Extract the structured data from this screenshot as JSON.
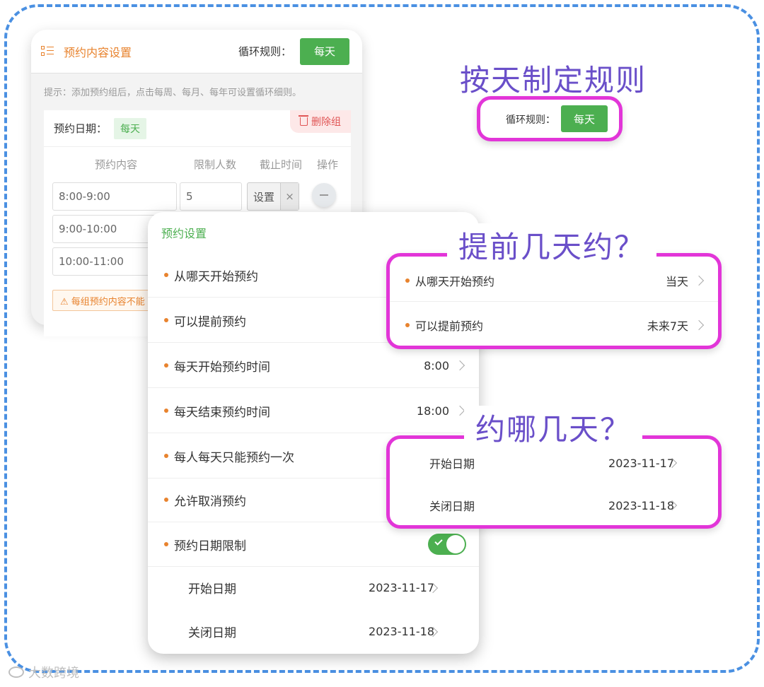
{
  "back_card": {
    "title": "预约内容设置",
    "rule_label": "循环规则：",
    "rule_value": "每天",
    "tip": "提示：添加预约组后，点击每周、每月、每年可设置循环细则。",
    "group": {
      "date_label": "预约日期：",
      "date_tag": "每天",
      "delete_label": "删除组",
      "columns": [
        "预约内容",
        "限制人数",
        "截止时间",
        "操作"
      ],
      "rows": [
        {
          "content": "8:00-9:00",
          "limit": "5",
          "set_label": "设置",
          "clear": "×"
        },
        {
          "content": "9:00-10:00"
        },
        {
          "content": "10:00-11:00"
        }
      ],
      "warning": "⚠ 每组预约内容不能"
    }
  },
  "front_card": {
    "title": "预约设置",
    "rows": [
      {
        "label": "从哪天开始预约",
        "value": ""
      },
      {
        "label": "可以提前预约",
        "value": ""
      },
      {
        "label": "每天开始预约时间",
        "value": "8:00"
      },
      {
        "label": "每天结束预约时间",
        "value": "18:00"
      },
      {
        "label": "每人每天只能预约一次",
        "value": ""
      },
      {
        "label": "允许取消预约",
        "value": ""
      },
      {
        "label": "预约日期限制",
        "value": ""
      }
    ],
    "date_limit_enabled": true,
    "sub_rows": [
      {
        "label": "开始日期",
        "value": "2023-11-17"
      },
      {
        "label": "关闭日期",
        "value": "2023-11-18"
      }
    ]
  },
  "annotations": {
    "rule_heading": "按天制定规则",
    "rule_box": {
      "label": "循环规则：",
      "value": "每天"
    },
    "advance_heading": "提前几天约？",
    "advance_box": [
      {
        "label": "从哪天开始预约",
        "value": "当天"
      },
      {
        "label": "可以提前预约",
        "value": "未来7天"
      }
    ],
    "days_heading": "约哪几天？",
    "days_box": [
      {
        "label": "开始日期",
        "value": "2023-11-17"
      },
      {
        "label": "关闭日期",
        "value": "2023-11-18"
      }
    ]
  },
  "watermark": "大数跨境",
  "colors": {
    "accent_green": "#4caf50",
    "accent_orange": "#e8832e",
    "highlight_magenta": "#e235d8",
    "frame_blue": "#4a90e2"
  }
}
